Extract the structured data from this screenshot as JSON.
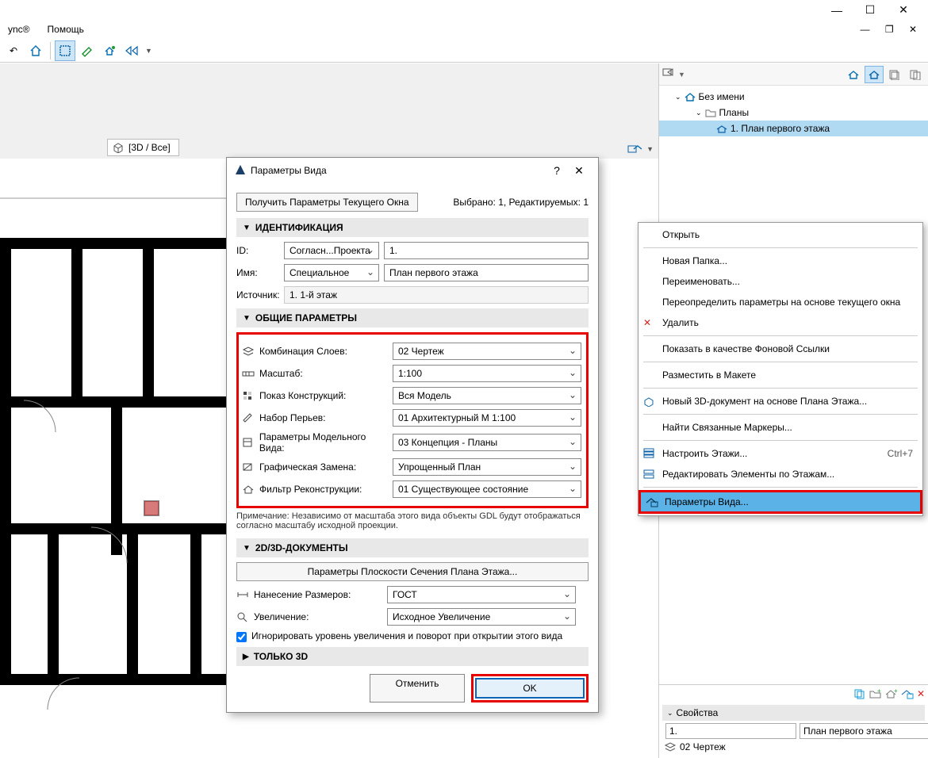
{
  "menubar": {
    "items": [
      "ync®",
      "Помощь"
    ]
  },
  "tab3d_label": "[3D / Все]",
  "dialog": {
    "title": "Параметры Вида",
    "get_current": "Получить Параметры Текущего Окна",
    "selected_info": "Выбрано: 1, Редактируемых: 1",
    "section_ident": "ИДЕНТИФИКАЦИЯ",
    "id_label": "ID:",
    "id_mode": "Согласн...Проекта",
    "id_value": "1.",
    "name_label": "Имя:",
    "name_mode": "Специальное",
    "name_value": "План первого этажа",
    "source_label": "Источник:",
    "source_value": "1. 1-й этаж",
    "section_general": "ОБЩИЕ ПАРАМЕТРЫ",
    "layer_label": "Комбинация Слоев:",
    "layer_value": "02 Чертеж",
    "scale_label": "Масштаб:",
    "scale_value": "1:100",
    "constr_label": "Показ Конструкций:",
    "constr_value": "Вся Модель",
    "pens_label": "Набор Перьев:",
    "pens_value": "01 Архитектурный М 1:100",
    "mvo_label": "Параметры Модельного Вида:",
    "mvo_value": "03 Концепция - Планы",
    "go_label": "Графическая Замена:",
    "go_value": "Упрощенный План",
    "reno_label": "Фильтр Реконструкции:",
    "reno_value": "01 Существующее состояние",
    "note": "Примечание: Независимо от масштаба этого вида объекты GDL будут отображаться согласно масштабу исходной проекции.",
    "section_2d3d": "2D/3D-ДОКУМЕНТЫ",
    "fcp_button": "Параметры Плоскости Сечения Плана Этажа...",
    "dims_label": "Нанесение Размеров:",
    "dims_value": "ГОСТ",
    "zoom_label": "Увеличение:",
    "zoom_value": "Исходное Увеличение",
    "zoom_checkbox": "Игнорировать уровень увеличения и поворот при открытии этого вида",
    "section_3donly": "ТОЛЬКО 3D",
    "cancel": "Отменить",
    "ok": "OK"
  },
  "ctx": {
    "open": "Открыть",
    "new_folder": "Новая Папка...",
    "rename": "Переименовать...",
    "redefine": "Переопределить параметры на основе текущего окна",
    "delete": "Удалить",
    "show_bg": "Показать в качестве Фоновой Ссылки",
    "place_layout": "Разместить в Макете",
    "new_3ddoc": "Новый 3D-документ на основе Плана Этажа...",
    "find_markers": "Найти Связанные Маркеры...",
    "story_settings": "Настроить Этажи...",
    "story_edit": "Редактировать Элементы по Этажам...",
    "view_settings": "Параметры Вида...",
    "shortcut_story": "Ctrl+7"
  },
  "tree": {
    "root": "Без имени",
    "folder": "Планы",
    "item": "1. План первого этажа"
  },
  "props": {
    "header": "Свойства",
    "id": "1.",
    "name": "План первого этажа",
    "layers": "02 Чертеж"
  }
}
